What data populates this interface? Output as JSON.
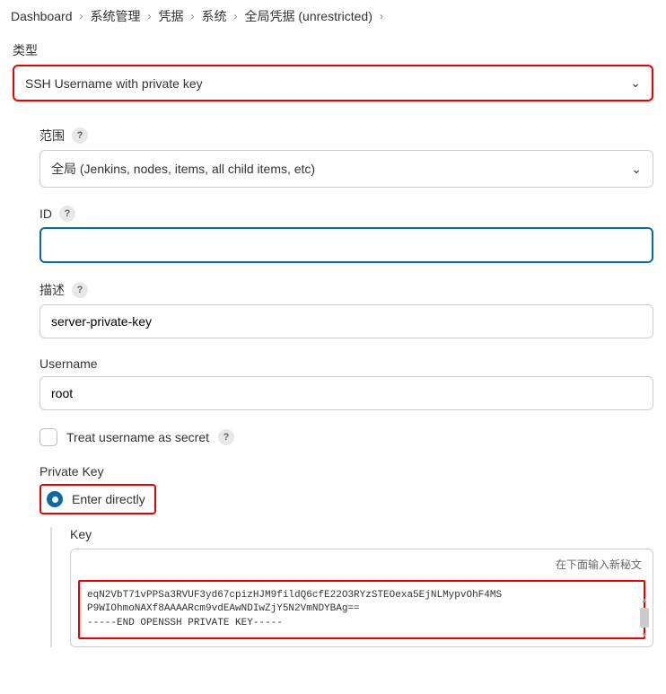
{
  "breadcrumb": {
    "items": [
      {
        "label": "Dashboard"
      },
      {
        "label": "系统管理"
      },
      {
        "label": "凭据"
      },
      {
        "label": "系统"
      },
      {
        "label": "全局凭据 (unrestricted)"
      }
    ]
  },
  "kind": {
    "label": "类型",
    "value": "SSH Username with private key"
  },
  "scope": {
    "label": "范围",
    "value": "全局 (Jenkins, nodes, items, all child items, etc)"
  },
  "id": {
    "label": "ID",
    "value": ""
  },
  "description": {
    "label": "描述",
    "value": "server-private-key"
  },
  "username": {
    "label": "Username",
    "value": "root"
  },
  "treatSecret": {
    "label": "Treat username as secret"
  },
  "privateKey": {
    "label": "Private Key",
    "optionEnterDirectly": "Enter directly",
    "keyLabel": "Key",
    "hint": "在下面输入新秘文",
    "content_line1": "eqN2VbT71vPPSa3RVUF3yd67cpizHJM9fildQ6cfE22O3RYzSTEOexa5EjNLMypvOhF4MS",
    "content_line2": "P9WIOhmoNAXf8AAAARcm9vdEAwNDIwZjY5N2VmNDYBAg==",
    "content_line3": "-----END OPENSSH PRIVATE KEY-----"
  }
}
